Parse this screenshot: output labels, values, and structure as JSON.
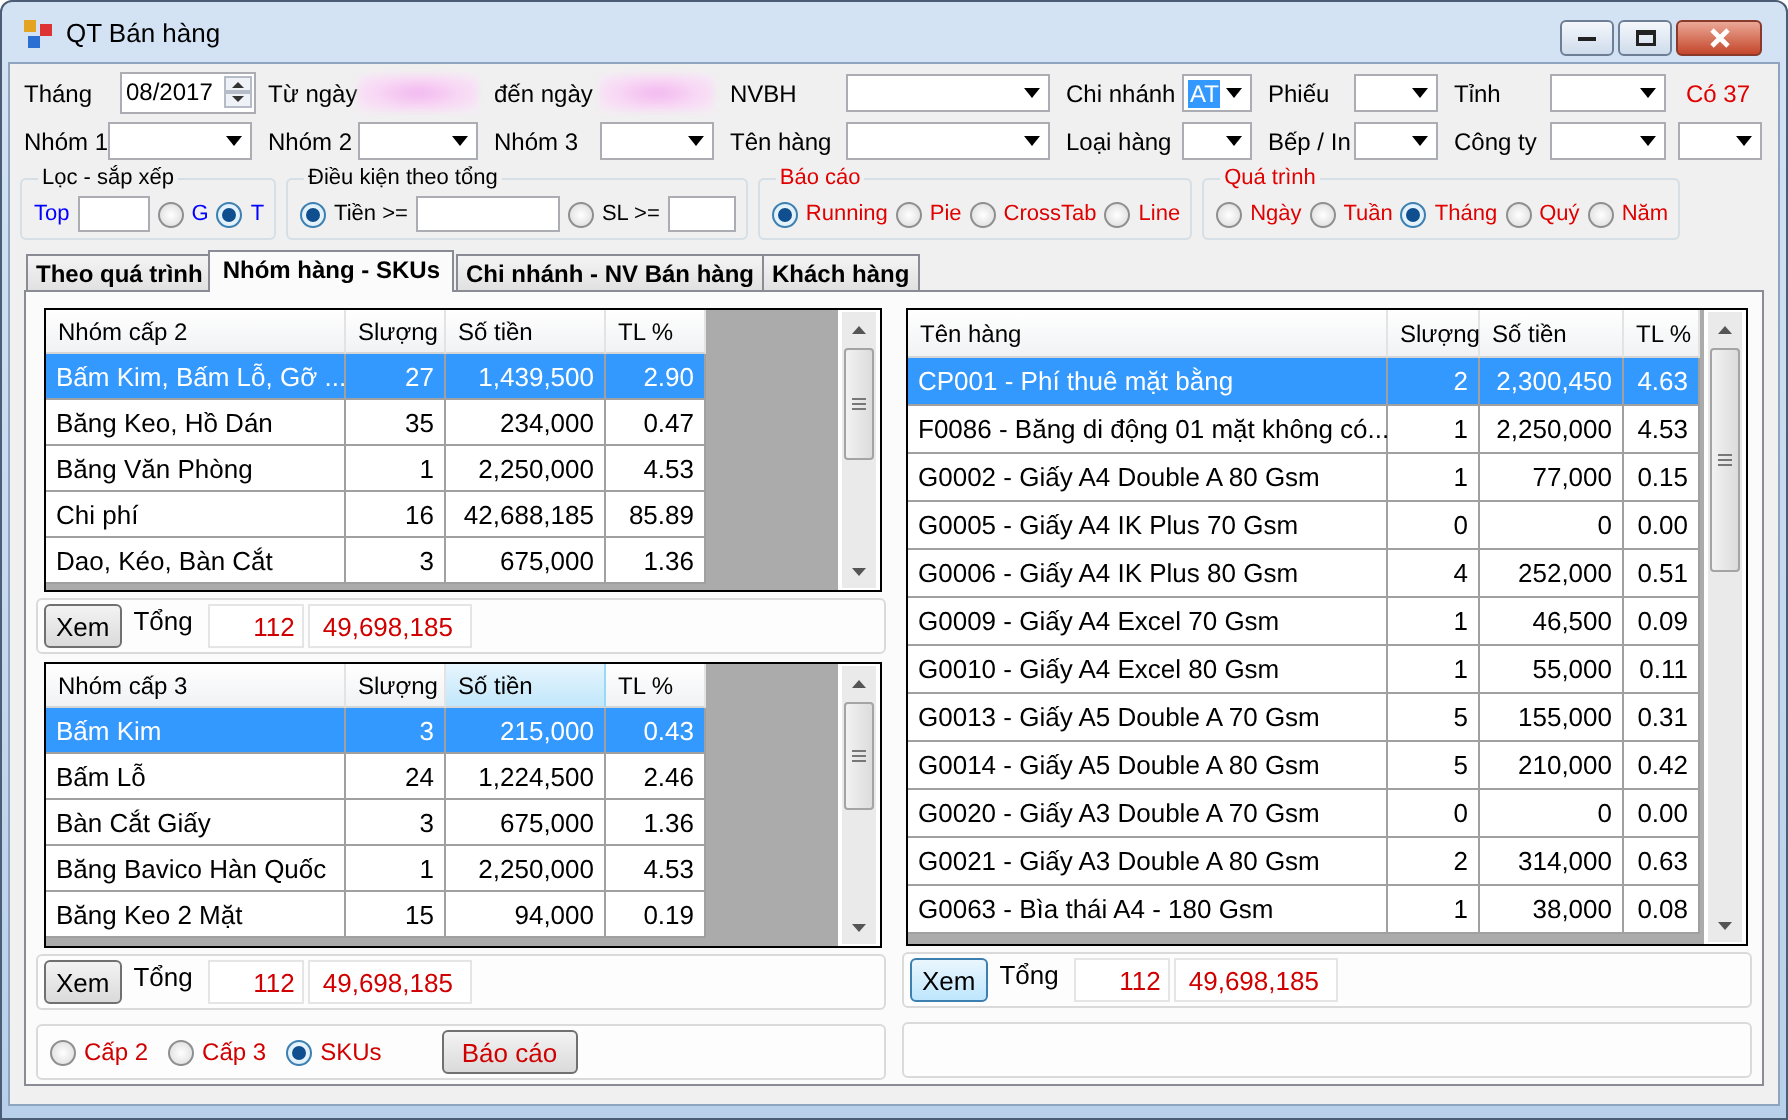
{
  "window": {
    "title": "QT Bán hàng"
  },
  "filters": {
    "row1": [
      {
        "kind": "spinner",
        "label": "Tháng",
        "value": "08/2017"
      },
      {
        "kind": "blurred",
        "label": "Từ ngày"
      },
      {
        "kind": "blurred",
        "label": "đến ngày"
      },
      {
        "kind": "combo",
        "label": "NVBH"
      },
      {
        "kind": "combo",
        "label": "Chi nhánh",
        "value": "AT",
        "highlighted": true
      },
      {
        "kind": "combo",
        "label": "Phiếu"
      },
      {
        "kind": "combo",
        "label": "Tỉnh"
      },
      {
        "kind": "note",
        "text": "Có 37"
      }
    ],
    "row2": [
      {
        "kind": "combo",
        "label": "Nhóm 1"
      },
      {
        "kind": "combo",
        "label": "Nhóm 2"
      },
      {
        "kind": "combo",
        "label": "Nhóm 3"
      },
      {
        "kind": "combo",
        "label": "Tên hàng"
      },
      {
        "kind": "combo",
        "label": "Loại hàng"
      },
      {
        "kind": "combo",
        "label": "Bếp / In"
      },
      {
        "kind": "combo",
        "label": "Công ty"
      },
      {
        "kind": "combo"
      }
    ]
  },
  "groups": [
    {
      "title": "Lọc - sắp xếp",
      "kind": "filter",
      "color": "#0000ff",
      "items": [
        {
          "kind": "text",
          "text": "Top"
        },
        {
          "kind": "input"
        },
        {
          "kind": "radio",
          "label": "G",
          "selected": false
        },
        {
          "kind": "radio",
          "label": "T",
          "selected": true
        }
      ]
    },
    {
      "title": "Điều kiện theo tổng",
      "kind": "filter",
      "color": "#000000",
      "items": [
        {
          "kind": "radio",
          "label": "Tiền >=",
          "selected": true
        },
        {
          "kind": "input"
        },
        {
          "kind": "radio",
          "label": "SL >=",
          "selected": false
        },
        {
          "kind": "input"
        }
      ]
    },
    {
      "title": "Báo cáo",
      "kind": "report",
      "color": "#e00000",
      "items": [
        {
          "kind": "radio",
          "label": "Running",
          "selected": true
        },
        {
          "kind": "radio",
          "label": "Pie",
          "selected": false
        },
        {
          "kind": "radio",
          "label": "CrossTab",
          "selected": false
        },
        {
          "kind": "radio",
          "label": "Line",
          "selected": false
        }
      ]
    },
    {
      "title": "Quá trình",
      "kind": "report",
      "color": "#e00000",
      "items": [
        {
          "kind": "radio",
          "label": "Ngày",
          "selected": false
        },
        {
          "kind": "radio",
          "label": "Tuần",
          "selected": false
        },
        {
          "kind": "radio",
          "label": "Tháng",
          "selected": true
        },
        {
          "kind": "radio",
          "label": "Quý",
          "selected": false
        },
        {
          "kind": "radio",
          "label": "Năm",
          "selected": false
        }
      ]
    }
  ],
  "tabs": [
    {
      "label": "Theo quá trình",
      "selected": false
    },
    {
      "label": "Nhóm hàng - SKUs",
      "selected": true
    },
    {
      "label": "Chi nhánh - NV Bán hàng",
      "selected": false
    },
    {
      "label": "Khách hàng",
      "selected": false
    }
  ],
  "grids": [
    {
      "columns": [
        {
          "label": "Nhóm cấp 2",
          "sorted": false
        },
        {
          "label": "Slượng",
          "sorted": false
        },
        {
          "label": "Số tiền",
          "sorted": false
        },
        {
          "label": "TL %",
          "sorted": false
        }
      ],
      "rows": [
        {
          "cells": [
            "Bấm Kim, Bấm Lỗ, Gỡ ...",
            "27",
            "1,439,500",
            "2.90"
          ],
          "selected": true
        },
        {
          "cells": [
            "Băng Keo, Hồ Dán",
            "35",
            "234,000",
            "0.47"
          ],
          "selected": false
        },
        {
          "cells": [
            "Băng Văn Phòng",
            "1",
            "2,250,000",
            "4.53"
          ],
          "selected": false
        },
        {
          "cells": [
            "Chi phí",
            "16",
            "42,688,185",
            "85.89"
          ],
          "selected": false
        },
        {
          "cells": [
            "Dao, Kéo, Bàn Cắt",
            "3",
            "675,000",
            "1.36"
          ],
          "selected": false
        }
      ],
      "totals": {
        "button": "Xem",
        "label": "Tổng",
        "count": "112",
        "amount": "49,698,185",
        "focused": false
      }
    },
    {
      "columns": [
        {
          "label": "Nhóm cấp 3",
          "sorted": false
        },
        {
          "label": "Slượng",
          "sorted": false
        },
        {
          "label": "Số tiền",
          "sorted": true
        },
        {
          "label": "TL %",
          "sorted": false
        }
      ],
      "rows": [
        {
          "cells": [
            "Bấm Kim",
            "3",
            "215,000",
            "0.43"
          ],
          "selected": true
        },
        {
          "cells": [
            "Bấm Lỗ",
            "24",
            "1,224,500",
            "2.46"
          ],
          "selected": false
        },
        {
          "cells": [
            "Bàn Cắt Giấy",
            "3",
            "675,000",
            "1.36"
          ],
          "selected": false
        },
        {
          "cells": [
            "Băng Bavico Hàn Quốc",
            "1",
            "2,250,000",
            "4.53"
          ],
          "selected": false
        },
        {
          "cells": [
            "Băng Keo 2 Mặt",
            "15",
            "94,000",
            "0.19"
          ],
          "selected": false
        }
      ],
      "totals": {
        "button": "Xem",
        "label": "Tổng",
        "count": "112",
        "amount": "49,698,185",
        "focused": false
      }
    },
    {
      "columns": [
        {
          "label": "Tên hàng",
          "sorted": false
        },
        {
          "label": "Slượng",
          "sorted": false
        },
        {
          "label": "Số tiền",
          "sorted": false
        },
        {
          "label": "TL %",
          "sorted": false
        }
      ],
      "rows": [
        {
          "cells": [
            "CP001 - Phí thuê mặt bằng",
            "2",
            "2,300,450",
            "4.63"
          ],
          "selected": true
        },
        {
          "cells": [
            "F0086 - Băng di động 01 mặt không có...",
            "1",
            "2,250,000",
            "4.53"
          ],
          "selected": false
        },
        {
          "cells": [
            "G0002 - Giấy A4 Double A 80 Gsm",
            "1",
            "77,000",
            "0.15"
          ],
          "selected": false
        },
        {
          "cells": [
            "G0005 - Giấy A4 IK Plus 70 Gsm",
            "0",
            "0",
            "0.00"
          ],
          "selected": false
        },
        {
          "cells": [
            "G0006 - Giấy A4 IK Plus 80 Gsm",
            "4",
            "252,000",
            "0.51"
          ],
          "selected": false
        },
        {
          "cells": [
            "G0009 - Giấy A4 Excel 70 Gsm",
            "1",
            "46,500",
            "0.09"
          ],
          "selected": false
        },
        {
          "cells": [
            "G0010 - Giấy A4 Excel 80 Gsm",
            "1",
            "55,000",
            "0.11"
          ],
          "selected": false
        },
        {
          "cells": [
            "G0013 - Giấy A5 Double A 70 Gsm",
            "5",
            "155,000",
            "0.31"
          ],
          "selected": false
        },
        {
          "cells": [
            "G0014 - Giấy A5 Double A 80 Gsm",
            "5",
            "210,000",
            "0.42"
          ],
          "selected": false
        },
        {
          "cells": [
            "G0020 - Giấy A3 Double A 70 Gsm",
            "0",
            "0",
            "0.00"
          ],
          "selected": false
        },
        {
          "cells": [
            "G0021 - Giấy A3 Double A 80 Gsm",
            "2",
            "314,000",
            "0.63"
          ],
          "selected": false
        },
        {
          "cells": [
            "G0063 - Bìa thái A4 -  180 Gsm",
            "1",
            "38,000",
            "0.08"
          ],
          "selected": false
        }
      ],
      "totals": {
        "button": "Xem",
        "label": "Tổng",
        "count": "112",
        "amount": "49,698,185",
        "focused": true
      }
    }
  ],
  "options": {
    "radios": [
      {
        "label": "Cấp 2",
        "selected": false
      },
      {
        "label": "Cấp 3",
        "selected": false
      },
      {
        "label": "SKUs",
        "selected": true
      }
    ],
    "button": "Báo cáo"
  }
}
